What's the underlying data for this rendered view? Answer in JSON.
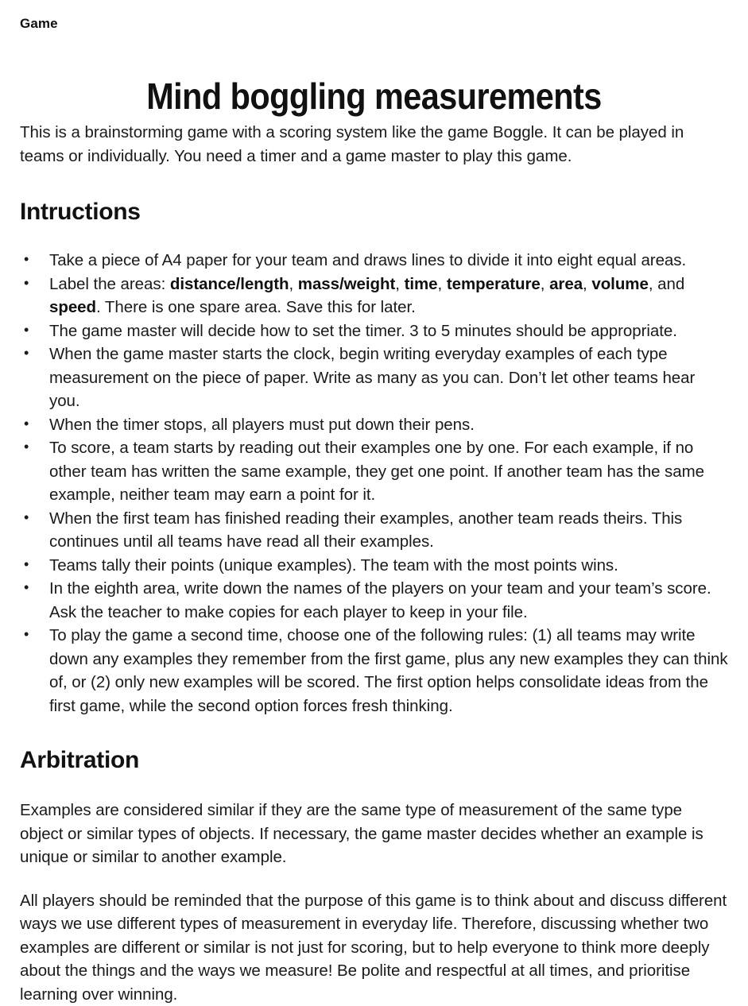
{
  "category_label": "Game",
  "title": "Mind boggling measurements",
  "intro_paragraph": "This is a brainstorming game with a scoring system like the game Boggle. It can be played in teams or individually. You need a timer and a game master to play this game.",
  "sections": {
    "instructions": {
      "heading": "Intructions",
      "items": [
        {
          "parts": [
            {
              "text": "Take a piece of A4 paper for your team and draws lines to divide it into eight equal areas.",
              "bold": false
            }
          ]
        },
        {
          "parts": [
            {
              "text": "Label the areas: ",
              "bold": false
            },
            {
              "text": "distance/length",
              "bold": true
            },
            {
              "text": ", ",
              "bold": false
            },
            {
              "text": "mass/weight",
              "bold": true
            },
            {
              "text": ", ",
              "bold": false
            },
            {
              "text": "time",
              "bold": true
            },
            {
              "text": ", ",
              "bold": false
            },
            {
              "text": "temperature",
              "bold": true
            },
            {
              "text": ", ",
              "bold": false
            },
            {
              "text": "area",
              "bold": true
            },
            {
              "text": ", ",
              "bold": false
            },
            {
              "text": "volume",
              "bold": true
            },
            {
              "text": ", and ",
              "bold": false
            },
            {
              "text": "speed",
              "bold": true
            },
            {
              "text": ". There is one spare area. Save this for later.",
              "bold": false
            }
          ]
        },
        {
          "parts": [
            {
              "text": "The game master will decide how to set the timer. 3 to 5 minutes should be appropriate.",
              "bold": false
            }
          ]
        },
        {
          "parts": [
            {
              "text": "When the game master starts the clock, begin writing everyday examples of each type measurement on the piece of paper. Write as many as you can. Don’t let other teams hear you.",
              "bold": false
            }
          ]
        },
        {
          "parts": [
            {
              "text": "When the timer stops, all players must put down their pens.",
              "bold": false
            }
          ]
        },
        {
          "parts": [
            {
              "text": "To score, a team starts by reading out their examples one by one. For each example, if no other team has written the same example, they get one point. If another team has the same example, neither team may earn a point for it.",
              "bold": false
            }
          ]
        },
        {
          "parts": [
            {
              "text": "When the first team has finished reading their examples, another team reads theirs. This continues until all teams have read all their examples.",
              "bold": false
            }
          ]
        },
        {
          "parts": [
            {
              "text": "Teams tally their points (unique examples). The team with the most points wins.",
              "bold": false
            }
          ]
        },
        {
          "parts": [
            {
              "text": "In the eighth area, write down the names of the players on your team and your team’s score. Ask the teacher to make copies for each player to keep in your file.",
              "bold": false
            }
          ]
        },
        {
          "parts": [
            {
              "text": "To play the game a second time, choose one of the following rules: (1) all teams may write down any examples they remember from the first game, plus any new examples they can think of, or (2) only new examples will be scored. The first option helps consolidate ideas from the first game, while the second option forces fresh thinking.",
              "bold": false
            }
          ]
        }
      ]
    },
    "arbitration": {
      "heading": "Arbitration",
      "paragraphs": [
        "Examples are considered similar if they are the same type of measurement of the same type object or similar types of objects. If necessary, the game master decides whether an example is unique or similar to another example.",
        "All players should be reminded that the purpose of this game is to think about and discuss different ways we use different types of measurement in everyday life. Therefore, discussing whether two examples are different or similar is not just for scoring, but to help everyone to think more deeply about the things and the ways we measure! Be polite and respectful at all times, and prioritise learning over winning."
      ]
    }
  },
  "colors": {
    "page_background": "#ffffff",
    "body_text": "#1a1a1a",
    "heading_text": "#111111"
  }
}
